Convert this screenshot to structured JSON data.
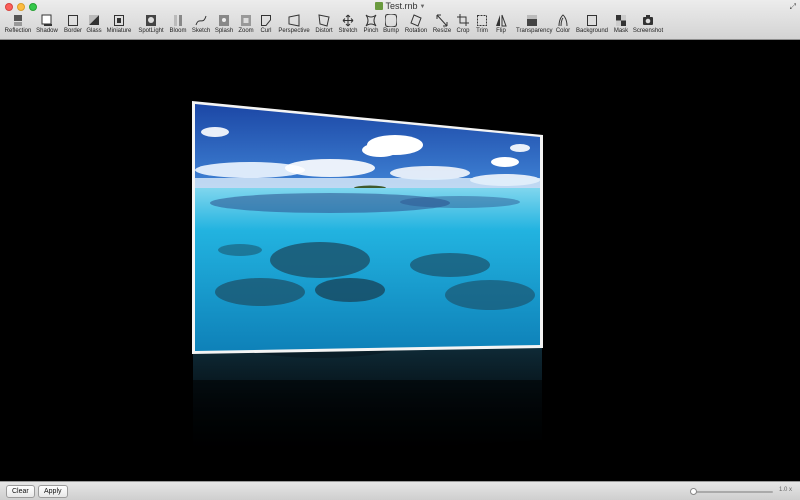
{
  "window": {
    "title": "Test.rnb"
  },
  "toolbar": {
    "tools": [
      {
        "label": "Reflection",
        "icon": "reflection-icon"
      },
      {
        "label": "Shadow",
        "icon": "shadow-icon"
      },
      {
        "label": "Border",
        "icon": "border-icon"
      },
      {
        "label": "Glass",
        "icon": "glass-icon"
      },
      {
        "label": "Miniature",
        "icon": "miniature-icon"
      },
      {
        "label": "SpotLight",
        "icon": "spotlight-icon"
      },
      {
        "label": "Bloom",
        "icon": "bloom-icon"
      },
      {
        "label": "Sketch",
        "icon": "sketch-icon"
      },
      {
        "label": "Splash",
        "icon": "splash-icon"
      },
      {
        "label": "Zoom",
        "icon": "zoom-icon"
      },
      {
        "label": "Curl",
        "icon": "curl-icon"
      },
      {
        "label": "Perspective",
        "icon": "perspective-icon"
      },
      {
        "label": "Distort",
        "icon": "distort-icon"
      },
      {
        "label": "Stretch",
        "icon": "stretch-icon"
      },
      {
        "label": "Pinch",
        "icon": "pinch-icon"
      },
      {
        "label": "Bump",
        "icon": "bump-icon"
      },
      {
        "label": "Rotation",
        "icon": "rotation-icon"
      },
      {
        "label": "Resize",
        "icon": "resize-icon"
      },
      {
        "label": "Crop",
        "icon": "crop-icon"
      },
      {
        "label": "Trim",
        "icon": "trim-icon"
      },
      {
        "label": "Flip",
        "icon": "flip-icon"
      },
      {
        "label": "Transparency",
        "icon": "transparency-icon"
      },
      {
        "label": "Color",
        "icon": "color-icon"
      },
      {
        "label": "Background",
        "icon": "background-icon"
      },
      {
        "label": "Mask",
        "icon": "mask-icon"
      },
      {
        "label": "Screenshot",
        "icon": "camera-icon"
      }
    ]
  },
  "bottom": {
    "clear_label": "Clear",
    "apply_label": "Apply",
    "zoom_label": "1.0 x"
  },
  "colors": {
    "sky_top": "#1d4fae",
    "sky_bottom": "#6aa8e6",
    "water": "#1fa9d8",
    "canvas": "#000000"
  }
}
